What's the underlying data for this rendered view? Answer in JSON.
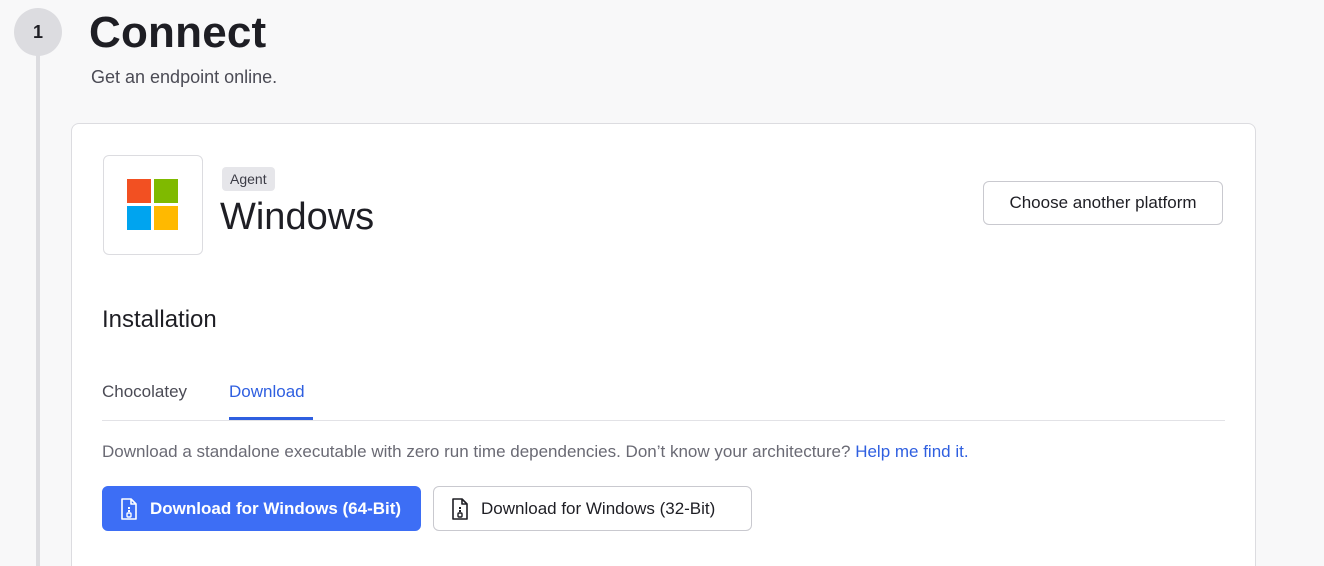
{
  "step": {
    "number": "1",
    "title": "Connect",
    "subtitle": "Get an endpoint online."
  },
  "platform": {
    "badge": "Agent",
    "name": "Windows",
    "logo_icon": "windows-logo-icon",
    "logo_colors": [
      "#f25022",
      "#7fba00",
      "#00a4ef",
      "#ffb900"
    ],
    "choose_button": "Choose another platform"
  },
  "installation": {
    "title": "Installation",
    "tabs": [
      {
        "label": "Chocolatey",
        "active": false
      },
      {
        "label": "Download",
        "active": true
      }
    ],
    "description": "Download a standalone executable with zero run time dependencies. Don’t know your architecture?",
    "help_link": "Help me find it.",
    "buttons": {
      "download_64": "Download for Windows (64-Bit)",
      "download_32": "Download for Windows (32-Bit)",
      "icon": "file-zip-icon"
    }
  },
  "colors": {
    "accent": "#3d6ef5",
    "link": "#2f5fe0",
    "border": "#dcdce0"
  }
}
